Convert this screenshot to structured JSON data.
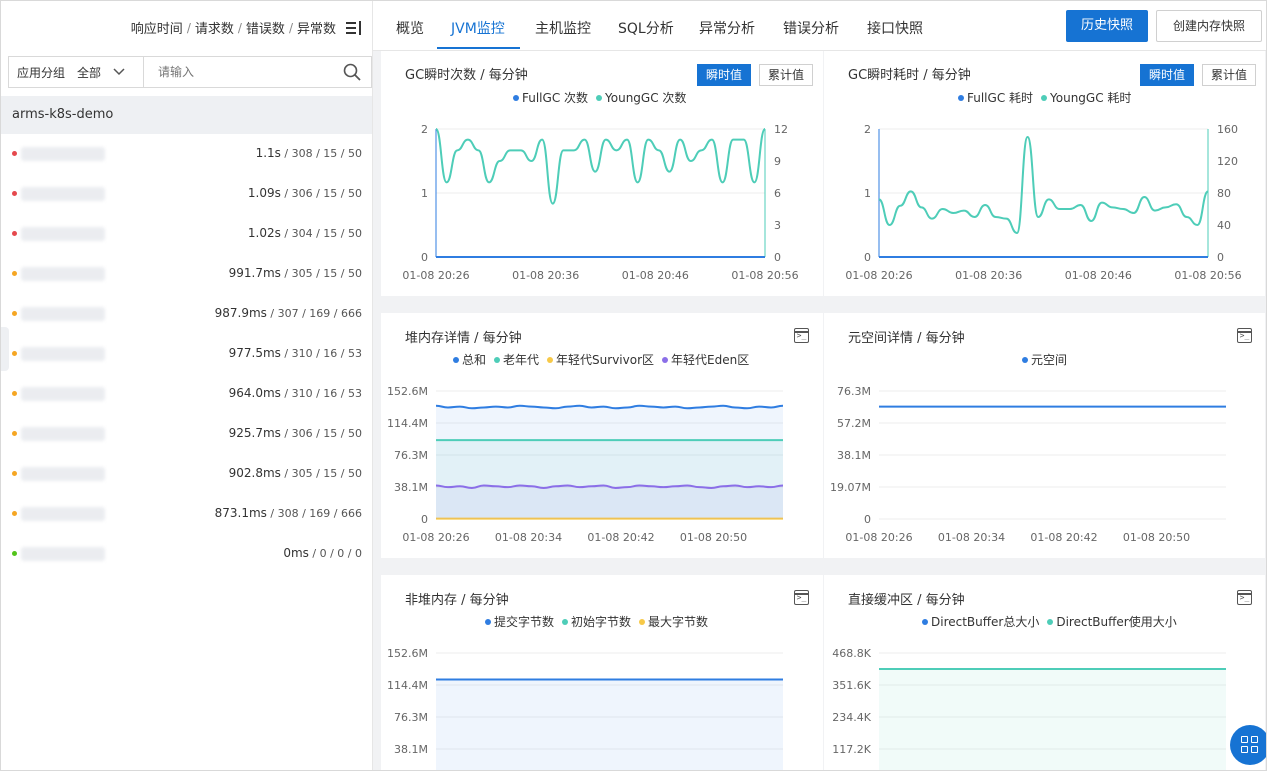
{
  "left": {
    "header": {
      "rt": "响应时间",
      "req": "请求数",
      "err": "错误数",
      "exc": "异常数"
    },
    "filter": {
      "group_label": "应用分组",
      "group_value": "全部",
      "search_placeholder": "请输入"
    },
    "app_group": "arms-k8s-demo",
    "rows": [
      {
        "color": "#e5484d",
        "rt": "1.1s",
        "rest": " / 308 / 15 / 50"
      },
      {
        "color": "#e5484d",
        "rt": "1.09s",
        "rest": " / 306 / 15 / 50"
      },
      {
        "color": "#e5484d",
        "rt": "1.02s",
        "rest": " / 304 / 15 / 50"
      },
      {
        "color": "#f5a623",
        "rt": "991.7ms",
        "rest": " / 305 / 15 / 50"
      },
      {
        "color": "#f5a623",
        "rt": "987.9ms",
        "rest": " / 307 / 169 / 666"
      },
      {
        "color": "#f5a623",
        "rt": "977.5ms",
        "rest": " / 310 / 16 / 53"
      },
      {
        "color": "#f5a623",
        "rt": "964.0ms",
        "rest": " / 310 / 16 / 53"
      },
      {
        "color": "#f5a623",
        "rt": "925.7ms",
        "rest": " / 306 / 15 / 50"
      },
      {
        "color": "#f5a623",
        "rt": "902.8ms",
        "rest": " / 305 / 15 / 50"
      },
      {
        "color": "#f5a623",
        "rt": "873.1ms",
        "rest": " / 308 / 169 / 666"
      },
      {
        "color": "#52c41a",
        "rt": "0ms",
        "rest": " / 0 / 0 / 0"
      }
    ]
  },
  "tabs": [
    "概览",
    "JVM监控",
    "主机监控",
    "SQL分析",
    "异常分析",
    "错误分析",
    "接口快照"
  ],
  "active_tab": "JVM监控",
  "buttons": {
    "history": "历史快照",
    "create": "创建内存快照",
    "instant": "瞬时值",
    "cumulative": "累计值"
  },
  "panels": {
    "gc_count": {
      "title": "GC瞬时次数 / 每分钟",
      "legend": [
        "FullGC 次数",
        "YoungGC 次数"
      ]
    },
    "gc_time": {
      "title": "GC瞬时耗时 / 每分钟",
      "legend": [
        "FullGC 耗时",
        "YoungGC 耗时"
      ]
    },
    "heap": {
      "title": "堆内存详情 / 每分钟",
      "legend": [
        "总和",
        "老年代",
        "年轻代Survivor区",
        "年轻代Eden区"
      ]
    },
    "meta": {
      "title": "元空间详情 / 每分钟",
      "legend": [
        "元空间"
      ]
    },
    "nonheap": {
      "title": "非堆内存 / 每分钟",
      "legend": [
        "提交字节数",
        "初始字节数",
        "最大字节数"
      ]
    },
    "direct": {
      "title": "直接缓冲区 / 每分钟",
      "legend": [
        "DirectBuffer总大小",
        "DirectBuffer使用大小"
      ]
    }
  },
  "colors": {
    "blue": "#2f7de1",
    "teal": "#4ecdb8",
    "yellow": "#f7c948",
    "purple": "#8b6fe8",
    "accent": "#1673d3"
  },
  "chart_data": [
    {
      "type": "line",
      "id": "gc_count",
      "x_ticks": [
        "01-08 20:26",
        "01-08 20:36",
        "01-08 20:46",
        "01-08 20:56"
      ],
      "y_left_ticks": [
        "0",
        "1",
        "2"
      ],
      "y_right_ticks": [
        "0",
        "3",
        "6",
        "9",
        "12"
      ],
      "ylim_left": [
        0,
        2
      ],
      "ylim_right": [
        0,
        12
      ],
      "series": [
        {
          "name": "FullGC 次数",
          "axis": "left",
          "values": [
            0,
            0,
            0,
            0,
            0,
            0,
            0,
            0,
            0,
            0,
            0,
            0,
            0,
            0,
            0,
            0,
            0,
            0,
            0,
            0,
            0,
            0,
            0,
            0,
            0,
            0,
            0,
            0,
            0,
            0,
            0,
            0
          ]
        },
        {
          "name": "YoungGC 次数",
          "axis": "right",
          "values": [
            12,
            7,
            10,
            11,
            10,
            7,
            9,
            10,
            10,
            9,
            11,
            5,
            10,
            10,
            11,
            8,
            11,
            10,
            11,
            7,
            11,
            10,
            8,
            11,
            9,
            10,
            11,
            7,
            11,
            11,
            7,
            12
          ]
        }
      ]
    },
    {
      "type": "line",
      "id": "gc_time",
      "x_ticks": [
        "01-08 20:26",
        "01-08 20:36",
        "01-08 20:46",
        "01-08 20:56"
      ],
      "y_left_ticks": [
        "0",
        "1",
        "2"
      ],
      "y_right_ticks": [
        "0",
        "40",
        "80",
        "120",
        "160"
      ],
      "ylim_left": [
        0,
        2
      ],
      "ylim_right": [
        0,
        160
      ],
      "series": [
        {
          "name": "FullGC 耗时",
          "axis": "left",
          "values": [
            0,
            0,
            0,
            0,
            0,
            0,
            0,
            0,
            0,
            0,
            0,
            0,
            0,
            0,
            0,
            0,
            0,
            0,
            0,
            0,
            0,
            0,
            0,
            0,
            0,
            0,
            0,
            0,
            0,
            0,
            0,
            0
          ]
        },
        {
          "name": "YoungGC 耗时",
          "axis": "right",
          "values": [
            72,
            40,
            64,
            82,
            62,
            48,
            60,
            55,
            58,
            50,
            65,
            50,
            48,
            30,
            150,
            50,
            72,
            60,
            60,
            65,
            45,
            68,
            62,
            60,
            55,
            75,
            58,
            62,
            66,
            50,
            40,
            82
          ]
        }
      ]
    },
    {
      "type": "area",
      "id": "heap",
      "x_ticks": [
        "01-08 20:26",
        "01-08 20:34",
        "01-08 20:42",
        "01-08 20:50"
      ],
      "y_ticks": [
        "0",
        "38.1M",
        "76.3M",
        "114.4M",
        "152.6M"
      ],
      "ylim": [
        0,
        152.6
      ],
      "series": [
        {
          "name": "总和",
          "values": [
            135,
            133,
            134,
            132,
            133,
            134,
            133,
            135,
            134,
            133,
            132,
            134,
            135,
            133,
            134,
            132,
            133,
            135,
            134,
            133,
            134,
            132,
            133,
            134,
            135,
            133,
            132,
            134,
            133,
            135
          ]
        },
        {
          "name": "老年代",
          "values": [
            94,
            94,
            94,
            94,
            94,
            94,
            94,
            94,
            94,
            94,
            94,
            94,
            94,
            94,
            94,
            94,
            94,
            94,
            94,
            94,
            94,
            94,
            94,
            94,
            94,
            94,
            94,
            94,
            94,
            94
          ]
        },
        {
          "name": "年轻代Survivor区",
          "values": [
            0.5,
            0.5,
            0.5,
            0.5,
            0.5,
            0.5,
            0.5,
            0.5,
            0.5,
            0.5,
            0.5,
            0.5,
            0.5,
            0.5,
            0.5,
            0.5,
            0.5,
            0.5,
            0.5,
            0.5,
            0.5,
            0.5,
            0.5,
            0.5,
            0.5,
            0.5,
            0.5,
            0.5,
            0.5,
            0.5
          ]
        },
        {
          "name": "年轻代Eden区",
          "values": [
            40,
            38,
            39,
            37,
            40,
            39,
            38,
            40,
            39,
            37,
            39,
            40,
            38,
            39,
            40,
            37,
            38,
            40,
            39,
            38,
            39,
            40,
            38,
            37,
            39,
            40,
            38,
            39,
            38,
            40
          ]
        }
      ]
    },
    {
      "type": "line",
      "id": "meta",
      "x_ticks": [
        "01-08 20:26",
        "01-08 20:34",
        "01-08 20:42",
        "01-08 20:50"
      ],
      "y_ticks": [
        "0",
        "19.07M",
        "38.1M",
        "57.2M",
        "76.3M"
      ],
      "ylim": [
        0,
        76.3
      ],
      "series": [
        {
          "name": "元空间",
          "values": [
            67,
            67,
            67,
            67,
            67,
            67,
            67,
            67,
            67,
            67
          ]
        }
      ]
    },
    {
      "type": "area",
      "id": "nonheap",
      "y_ticks": [
        "38.1M",
        "76.3M",
        "114.4M",
        "152.6M"
      ],
      "ylim": [
        0,
        152.6
      ],
      "series": [
        {
          "name": "提交字节数",
          "values": [
            121,
            121,
            121,
            121,
            121,
            121,
            121,
            121,
            121,
            121
          ]
        }
      ]
    },
    {
      "type": "area",
      "id": "direct",
      "y_ticks": [
        "117.2K",
        "234.4K",
        "351.6K",
        "468.8K"
      ],
      "ylim": [
        0,
        468.8
      ],
      "series": [
        {
          "name": "DirectBuffer使用大小",
          "values": [
            410,
            410,
            410,
            410,
            410,
            410,
            410,
            410,
            410,
            410
          ]
        }
      ]
    }
  ]
}
